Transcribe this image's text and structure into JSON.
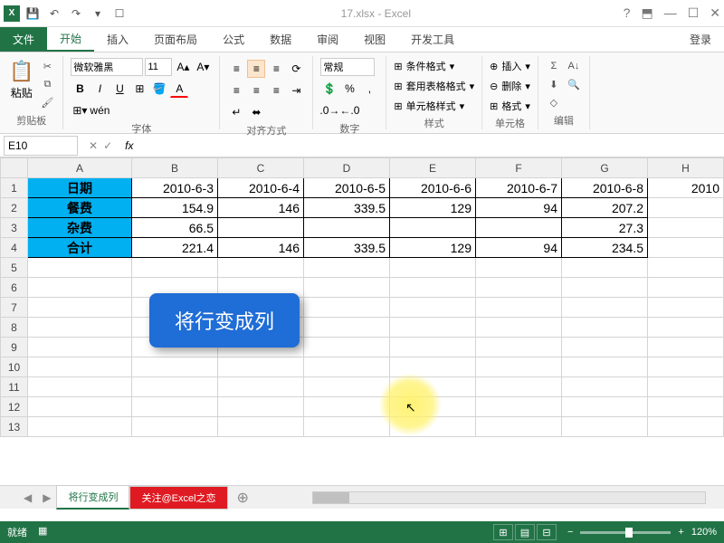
{
  "title": "17.xlsx - Excel",
  "ribbon_tabs": {
    "file": "文件",
    "home": "开始",
    "insert": "插入",
    "page_layout": "页面布局",
    "formulas": "公式",
    "data": "数据",
    "review": "审阅",
    "view": "视图",
    "developer": "开发工具",
    "login": "登录"
  },
  "groups": {
    "clipboard": "剪贴板",
    "paste": "粘贴",
    "font": "字体",
    "alignment": "对齐方式",
    "number": "数字",
    "styles": "样式",
    "cells": "单元格",
    "editing": "编辑"
  },
  "font": {
    "name": "微软雅黑",
    "size": "11"
  },
  "number_format": "常规",
  "styles_items": {
    "conditional": "条件格式",
    "table": "套用表格格式",
    "cell": "单元格样式"
  },
  "cells_items": {
    "insert": "插入",
    "delete": "删除",
    "format": "格式"
  },
  "name_box": "E10",
  "columns": [
    "A",
    "B",
    "C",
    "D",
    "E",
    "F",
    "G",
    "H"
  ],
  "rows": [
    "1",
    "2",
    "3",
    "4",
    "5",
    "6",
    "7",
    "8",
    "9",
    "10",
    "11",
    "12",
    "13"
  ],
  "data": {
    "r1": {
      "a": "日期",
      "b": "2010-6-3",
      "c": "2010-6-4",
      "d": "2010-6-5",
      "e": "2010-6-6",
      "f": "2010-6-7",
      "g": "2010-6-8",
      "h": "2010"
    },
    "r2": {
      "a": "餐费",
      "b": "154.9",
      "c": "146",
      "d": "339.5",
      "e": "129",
      "f": "94",
      "g": "207.2"
    },
    "r3": {
      "a": "杂费",
      "b": "66.5",
      "g": "27.3"
    },
    "r4": {
      "a": "合计",
      "b": "221.4",
      "c": "146",
      "d": "339.5",
      "e": "129",
      "f": "94",
      "g": "234.5"
    }
  },
  "callout": "将行变成列",
  "sheets": {
    "active": "将行变成列",
    "sheet2": "关注@Excel之恋"
  },
  "status": {
    "ready": "就绪",
    "scroll": "▦",
    "zoom": "120%"
  }
}
